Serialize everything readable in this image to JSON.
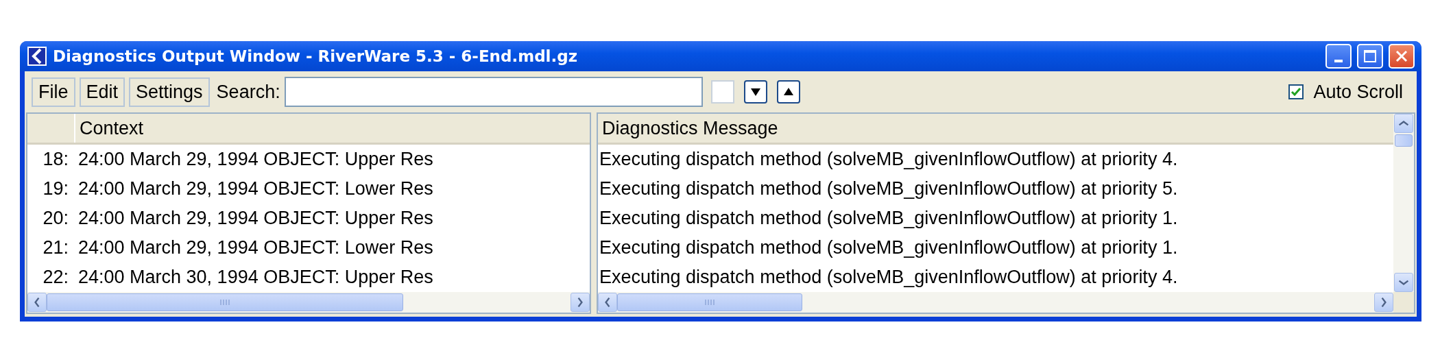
{
  "window": {
    "title": "Diagnostics Output Window - RiverWare 5.3 - 6-End.mdl.gz"
  },
  "menu": [
    "File",
    "Edit",
    "Settings"
  ],
  "search": {
    "label": "Search:",
    "toggle_checked": false
  },
  "auto_scroll": {
    "label": "Auto Scroll",
    "checked": true
  },
  "context_table": {
    "header": "Context",
    "rows": [
      {
        "number": "18:",
        "context": "24:00 March 29, 1994 OBJECT: Upper Res"
      },
      {
        "number": "19:",
        "context": "24:00 March 29, 1994 OBJECT: Lower Res"
      },
      {
        "number": "20:",
        "context": "24:00 March 29, 1994 OBJECT: Upper Res"
      },
      {
        "number": "21:",
        "context": "24:00 March 29, 1994 OBJECT: Lower Res"
      },
      {
        "number": "22:",
        "context": "24:00 March 30, 1994 OBJECT: Upper Res"
      }
    ]
  },
  "message_table": {
    "header": "Diagnostics Message",
    "rows": [
      "Executing dispatch method (solveMB_givenInflowOutflow) at priority 4.",
      "Executing dispatch method (solveMB_givenInflowOutflow) at priority 5.",
      "Executing dispatch method (solveMB_givenInflowOutflow) at priority 1.",
      "Executing dispatch method (solveMB_givenInflowOutflow) at priority 1.",
      "Executing dispatch method (solveMB_givenInflowOutflow) at priority 4."
    ]
  }
}
